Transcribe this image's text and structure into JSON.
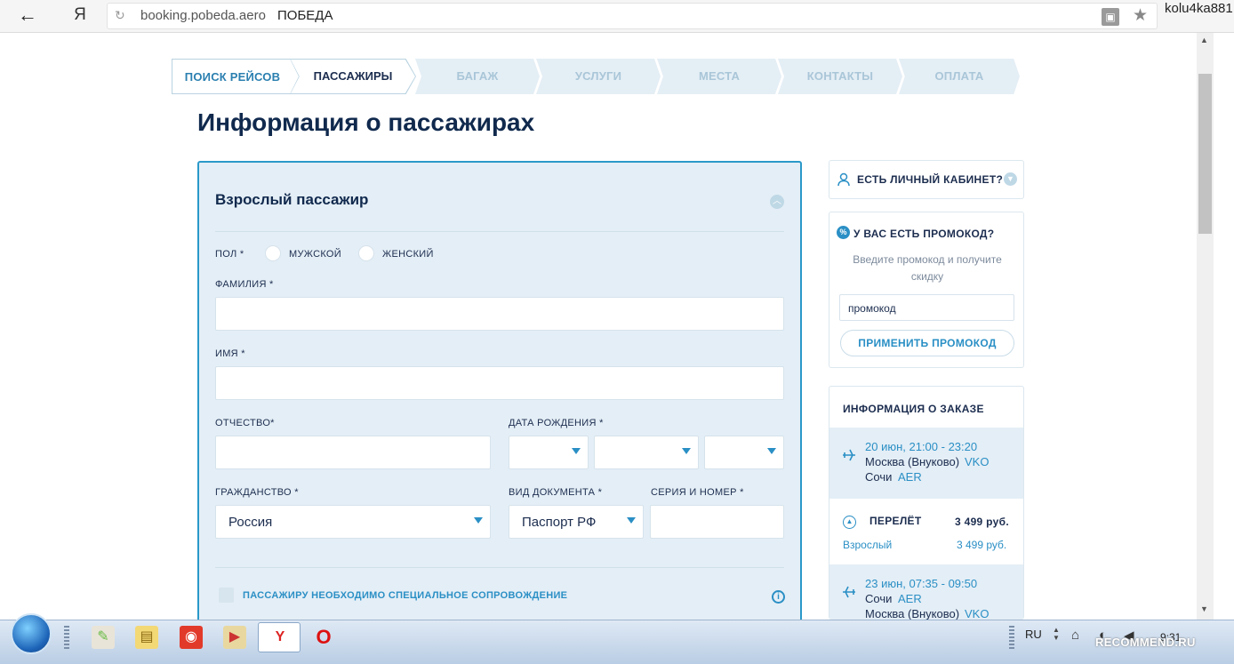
{
  "browser": {
    "back_glyph": "←",
    "yandex_glyph": "Я",
    "reload_glyph": "↻",
    "domain": "booking.pobeda.aero",
    "page_title": "ПОБЕДА",
    "user": "kolu4ka881",
    "star_glyph": "★",
    "lock_glyph": "▣"
  },
  "steps": [
    {
      "label": "ПОИСК РЕЙСОВ",
      "state": "done"
    },
    {
      "label": "ПАССАЖИРЫ",
      "state": "active"
    },
    {
      "label": "БАГАЖ",
      "state": "pending"
    },
    {
      "label": "УСЛУГИ",
      "state": "pending"
    },
    {
      "label": "МЕСТА",
      "state": "pending"
    },
    {
      "label": "КОНТАКТЫ",
      "state": "pending"
    },
    {
      "label": "ОПЛАТА",
      "state": "pending"
    }
  ],
  "page_title": "Информация о пассажирах",
  "form": {
    "title": "Взрослый пассажир",
    "collapse_glyph": "︿",
    "gender_label": "ПОЛ *",
    "gender_male": "МУЖСКОЙ",
    "gender_female": "ЖЕНСКИЙ",
    "surname_label": "ФАМИЛИЯ *",
    "surname_value": "",
    "name_label": "ИМЯ *",
    "name_value": "",
    "patronymic_label": "ОТЧЕСТВО*",
    "patronymic_value": "",
    "birthdate_label": "ДАТА РОЖДЕНИЯ *",
    "citizenship_label": "ГРАЖДАНСТВО *",
    "citizenship_value": "Россия",
    "doc_type_label": "ВИД ДОКУМЕНТА *",
    "doc_type_value": "Паспорт РФ",
    "doc_number_label": "СЕРИЯ И НОМЕР *",
    "doc_number_value": "",
    "escort_label": "ПАССАЖИРУ НЕОБХОДИМО СПЕЦИАЛЬНОЕ СОПРОВОЖДЕНИЕ",
    "info_glyph": "i"
  },
  "sidebar": {
    "cabinet_label": "ЕСТЬ ЛИЧНЫЙ КАБИНЕТ?",
    "promo_title": "У ВАС ЕСТЬ ПРОМОКОД?",
    "promo_hint": "Введите промокод и получите скидку",
    "promo_placeholder": "промокод",
    "promo_button": "ПРИМЕНИТЬ ПРОМОКОД",
    "order_title": "ИНФОРМАЦИЯ О ЗАКАЗЕ",
    "flight1": {
      "time": "20 июн, 21:00 - 23:20",
      "from": "Москва (Внуково)",
      "from_code": "VKO",
      "to": "Сочи",
      "to_code": "AER"
    },
    "flight_label": "ПЕРЕЛЁТ",
    "flight_price": "3 499 руб.",
    "adult_label": "Взрослый",
    "adult_price": "3 499 руб.",
    "flight2": {
      "time": "23 июн, 07:35 - 09:50",
      "from": "Сочи",
      "from_code": "AER",
      "to": "Москва (Внуково)",
      "to_code": "VKO"
    }
  },
  "taskbar": {
    "lang": "RU",
    "time": "9:31",
    "watermark": "RECOMMEND.RU"
  },
  "colors": {
    "accent": "#2a8fc5",
    "navy": "#10294d",
    "card_bg": "#e4eef6",
    "card_border": "#2a99c9"
  }
}
